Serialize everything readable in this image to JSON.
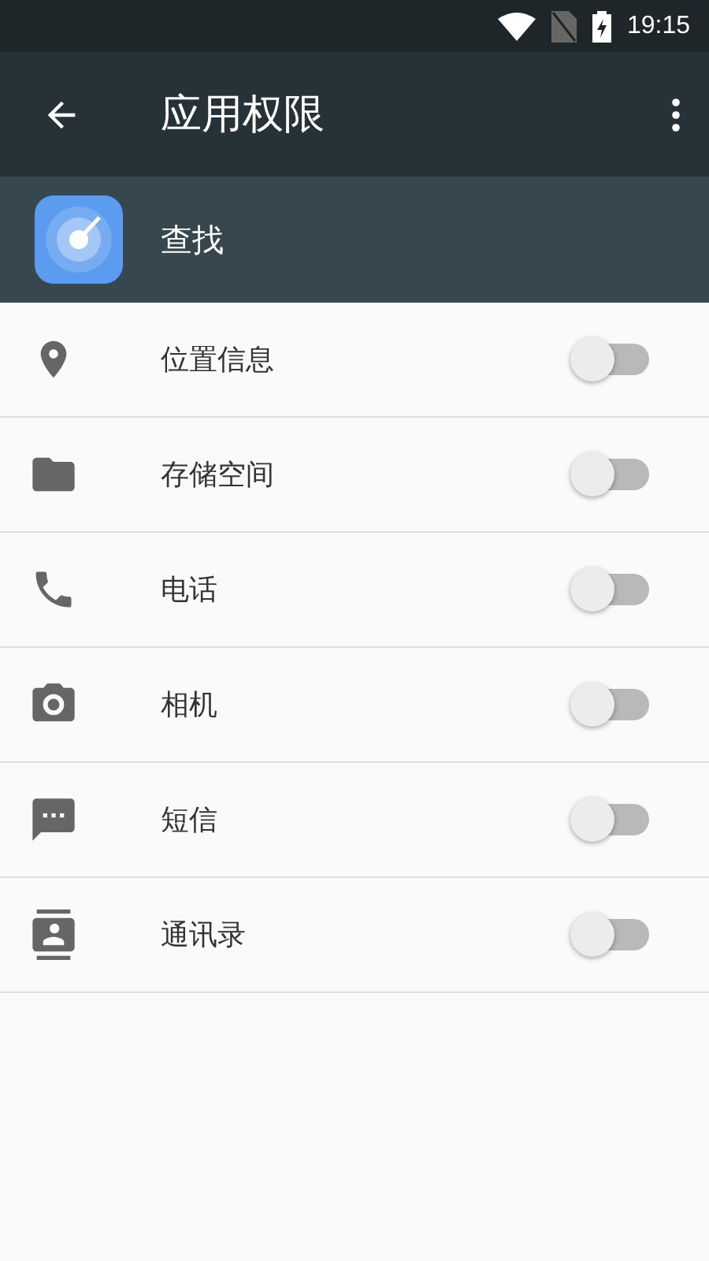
{
  "status_bar": {
    "time": "19:15"
  },
  "toolbar": {
    "title": "应用权限"
  },
  "app": {
    "name": "查找"
  },
  "permissions": [
    {
      "kind": "location",
      "label": "位置信息",
      "checked": false
    },
    {
      "kind": "storage",
      "label": "存储空间",
      "checked": false
    },
    {
      "kind": "phone",
      "label": "电话",
      "checked": false
    },
    {
      "kind": "camera",
      "label": "相机",
      "checked": false
    },
    {
      "kind": "sms",
      "label": "短信",
      "checked": false
    },
    {
      "kind": "contacts",
      "label": "通讯录",
      "checked": false
    }
  ]
}
